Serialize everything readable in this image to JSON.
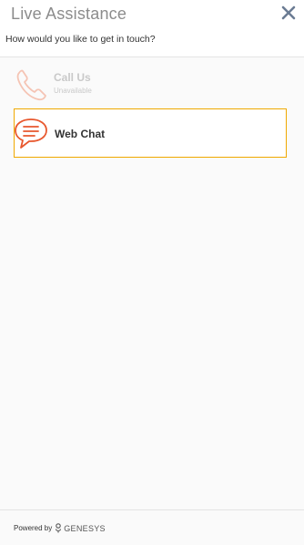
{
  "header": {
    "title": "Live Assistance",
    "subtitle": "How would you like to get in touch?",
    "close_icon": "close-icon"
  },
  "options": [
    {
      "label": "Call Us",
      "status": "Unavailable",
      "icon": "phone-icon",
      "enabled": false
    },
    {
      "label": "Web Chat",
      "icon": "chat-bubble-icon",
      "enabled": true
    }
  ],
  "footer": {
    "powered_by": "Powered by",
    "brand": "GENESYS"
  },
  "colors": {
    "accent_border": "#f0a800",
    "chat_icon": "#e8582e",
    "phone_icon_disabled": "#f5c4b4",
    "close_icon": "#6b7c93"
  }
}
